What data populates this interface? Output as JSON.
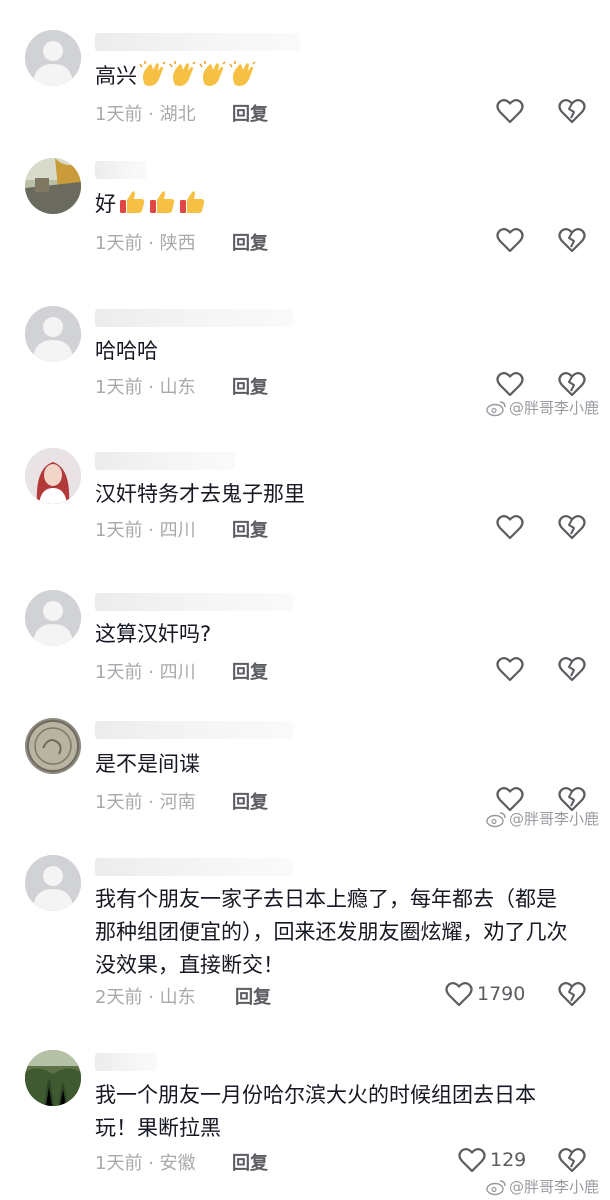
{
  "reply_label": "回复",
  "watermark": "@胖哥李小鹿",
  "comments": [
    {
      "text": "高兴",
      "meta": "1天前 · 湖北"
    },
    {
      "text": "好",
      "meta": "1天前 · 陕西"
    },
    {
      "text": "哈哈哈",
      "meta": "1天前 · 山东"
    },
    {
      "text": "汉奸特务才去鬼子那里",
      "meta": "1天前 · 四川"
    },
    {
      "text": "这算汉奸吗?",
      "meta": "1天前 · 四川"
    },
    {
      "text": "是不是间谍",
      "meta": "1天前 · 河南"
    },
    {
      "text": "我有个朋友一家子去日本上瘾了，每年都去（都是那种组团便宜的），回来还发朋友圈炫耀，劝了几次没效果，直接断交！",
      "meta": "2天前 · 山东",
      "likes": "1790"
    },
    {
      "text": "我一个朋友一月份哈尔滨大火的时候组团去日本玩！果断拉黑",
      "meta": "1天前 · 安徽",
      "likes": "129"
    }
  ],
  "icons": {
    "like": "heart-outline-icon",
    "dislike": "broken-heart-icon",
    "clap": "clapping-hands-emoji",
    "thumb": "thumbs-up-emoji",
    "weibo": "weibo-logo-icon"
  }
}
